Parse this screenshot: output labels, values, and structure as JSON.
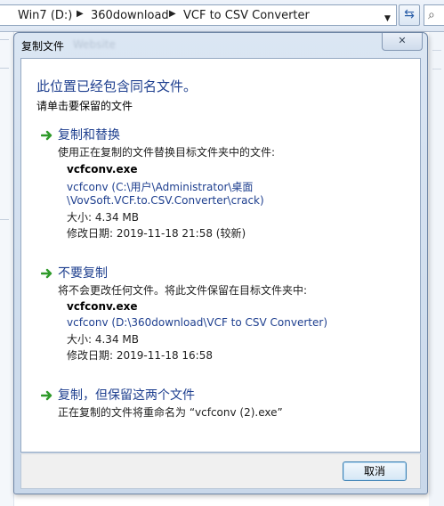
{
  "explorer": {
    "breadcrumbs": [
      "Win7 (D:)",
      "360download",
      "VCF to CSV Converter"
    ]
  },
  "dialog": {
    "title": "复制文件",
    "title_blurred": "Website",
    "heading": "此位置已经包含同名文件。",
    "subheading": "请单击要保留的文件",
    "options": [
      {
        "title": "复制和替换",
        "description": "使用正在复制的文件替换目标文件夹中的文件:",
        "file_name": "vcfconv.exe",
        "path_line1": "vcfconv (C:\\用户\\Administrator\\桌面",
        "path_line2": "\\VovSoft.VCF.to.CSV.Converter\\crack)",
        "size": "大小: 4.34 MB",
        "modified": "修改日期: 2019-11-18 21:58 (较新)"
      },
      {
        "title": "不要复制",
        "description": "将不会更改任何文件。将此文件保留在目标文件夹中:",
        "file_name": "vcfconv.exe",
        "path_line1": "vcfconv (D:\\360download\\VCF to CSV Converter)",
        "size": "大小: 4.34 MB",
        "modified": "修改日期: 2019-11-18 16:58"
      },
      {
        "title": "复制，但保留这两个文件",
        "description": "正在复制的文件将重命名为 “vcfconv (2).exe”"
      }
    ],
    "cancel_label": "取消"
  },
  "colors": {
    "link_blue": "#1e3f8f",
    "arrow_green": "#2f9a2a",
    "dialog_frame": "#c9d8ea"
  },
  "icons": [
    "arrow-right-icon",
    "refresh-icon",
    "search-icon",
    "close-icon"
  ]
}
